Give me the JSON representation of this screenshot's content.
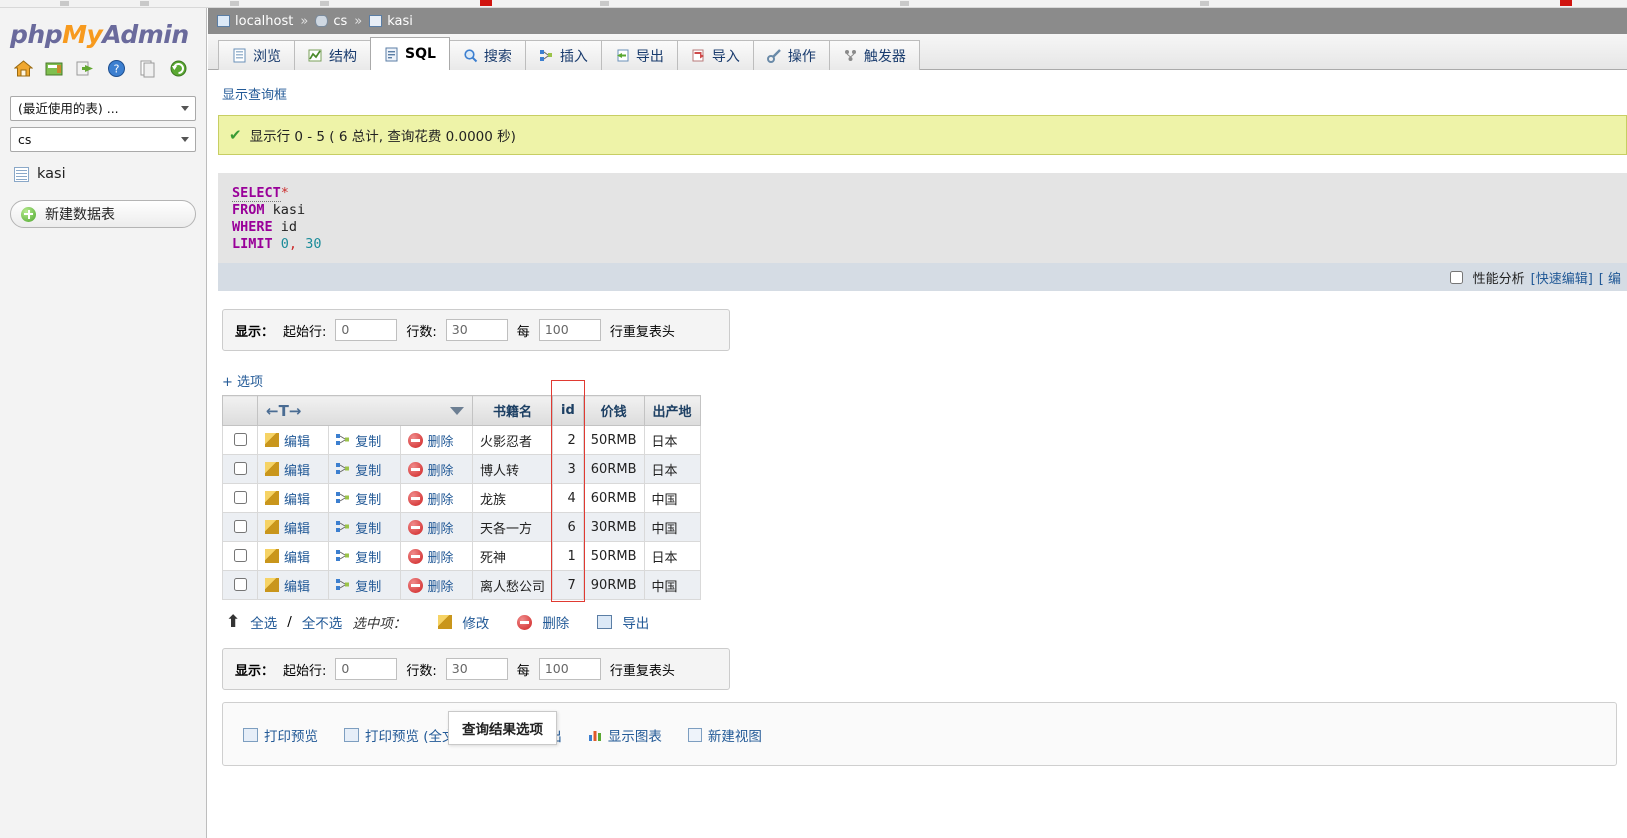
{
  "logo": {
    "php": "php",
    "my": "My",
    "admin": "Admin"
  },
  "nav_icons": [
    "home-icon",
    "sql-window-icon",
    "exit-icon",
    "help-icon",
    "docs-icon",
    "reload-icon"
  ],
  "sidebar": {
    "recent_tables_label": "(最近使用的表) ...",
    "database_label": "cs",
    "table_label": "kasi",
    "new_table_label": "新建数据表"
  },
  "breadcrumb": {
    "server": "localhost",
    "database": "cs",
    "table": "kasi",
    "separator": "»"
  },
  "tabs": [
    {
      "label": "浏览",
      "icon": "browse-icon",
      "active": false
    },
    {
      "label": "结构",
      "icon": "structure-icon",
      "active": false
    },
    {
      "label": "SQL",
      "icon": "sql-icon",
      "active": true
    },
    {
      "label": "搜索",
      "icon": "search-icon",
      "active": false
    },
    {
      "label": "插入",
      "icon": "insert-icon",
      "active": false
    },
    {
      "label": "导出",
      "icon": "export-icon",
      "active": false
    },
    {
      "label": "导入",
      "icon": "import-icon",
      "active": false
    },
    {
      "label": "操作",
      "icon": "operations-icon",
      "active": false
    },
    {
      "label": "触发器",
      "icon": "triggers-icon",
      "active": false
    }
  ],
  "show_query_box_link": "显示查询框",
  "success_message": "显示行 0 - 5 ( 6 总计, 查询花费 0.0000 秒)",
  "sql_query": {
    "line1_kw": "SELECT",
    "line1_star": "*",
    "line2_kw": "FROM",
    "line2_val": "kasi",
    "line3_kw": "WHERE",
    "line3_val": "id",
    "line4_kw": "LIMIT",
    "line4_a": "0",
    "line4_comma": ",",
    "line4_b": "30"
  },
  "sql_footer": {
    "profiling_label": "性能分析",
    "inline_edit": "[快速编辑]",
    "edit_partial": "[ 编"
  },
  "display_controls": {
    "label": "显示：",
    "start_row_label": "起始行:",
    "start_row_value": "0",
    "rows_label": "行数:",
    "rows_value": "30",
    "every_label": "每",
    "every_value": "100",
    "repeat_headers_label": "行重复表头"
  },
  "options_link": "+ 选项",
  "results": {
    "sort_header": "←T→",
    "columns": [
      "书籍名",
      "id",
      "价钱",
      "出产地"
    ],
    "row_actions": {
      "edit": "编辑",
      "copy": "复制",
      "delete": "删除"
    },
    "rows": [
      {
        "book": "火影忍者",
        "id": "2",
        "price": "50RMB",
        "origin": "日本"
      },
      {
        "book": "博人转",
        "id": "3",
        "price": "60RMB",
        "origin": "日本"
      },
      {
        "book": "龙族",
        "id": "4",
        "price": "60RMB",
        "origin": "中国"
      },
      {
        "book": "天各一方",
        "id": "6",
        "price": "30RMB",
        "origin": "中国"
      },
      {
        "book": "死神",
        "id": "1",
        "price": "50RMB",
        "origin": "日本"
      },
      {
        "book": "离人愁公司",
        "id": "7",
        "price": "90RMB",
        "origin": "中国"
      }
    ]
  },
  "bulk_actions": {
    "check_all": "全选",
    "slash": "/",
    "uncheck_all": "全不选",
    "with_selected": "选中项：",
    "modify": "修改",
    "delete": "删除",
    "export": "导出"
  },
  "query_results_legend": "查询结果选项",
  "bottom_links": [
    {
      "label": "打印预览",
      "icon": "print-icon"
    },
    {
      "label": "打印预览 (全文显示)",
      "icon": "print-full-icon"
    },
    {
      "label": "导出",
      "icon": "export-icon"
    },
    {
      "label": "显示图表",
      "icon": "chart-icon"
    },
    {
      "label": "新建视图",
      "icon": "view-icon"
    }
  ],
  "colors": {
    "breadcrumb_bg": "#8b8b8b",
    "success_bg": "#eef3a8",
    "success_border": "#c7ce63",
    "link": "#235a97",
    "keyword": "#990099",
    "highlight_box": "#e03a32",
    "brand_orange": "#f79a1e",
    "brand_blue": "#6a6a9c"
  }
}
